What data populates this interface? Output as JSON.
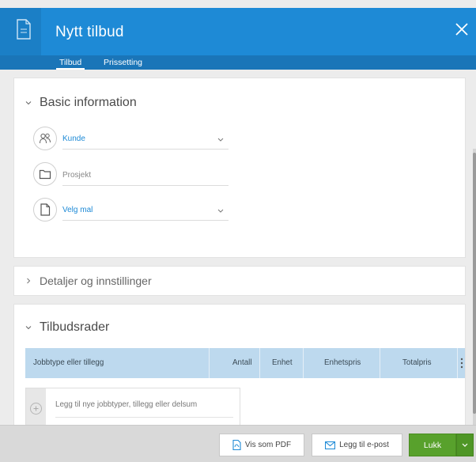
{
  "header": {
    "title": "Nytt tilbud",
    "close_icon": "close-icon",
    "doc_icon": "document-icon"
  },
  "tabs": [
    {
      "label": "Tilbud",
      "active": true
    },
    {
      "label": "Prissetting",
      "active": false
    }
  ],
  "basic": {
    "title": "Basic information",
    "fields": [
      {
        "label": "Kunde",
        "icon": "customer-icon",
        "has_dropdown": true
      },
      {
        "label": "Prosjekt",
        "icon": "folder-icon",
        "has_dropdown": false
      },
      {
        "label": "Velg mal",
        "icon": "template-icon",
        "has_dropdown": true
      }
    ]
  },
  "details": {
    "title": "Detaljer og innstillinger"
  },
  "lines": {
    "title": "Tilbudsrader",
    "columns": [
      "Jobbtype eller tillegg",
      "Antall",
      "Enhet",
      "Enhetspris",
      "Totalpris"
    ],
    "add_placeholder": "Legg til nye jobbtyper, tillegg eller delsum"
  },
  "footer": {
    "pdf_label": "Vis som PDF",
    "email_label": "Legg til e-post",
    "close_label": "Lukk"
  },
  "colors": {
    "primary": "#1e8ad6",
    "tab_bar": "#1a75b8",
    "success": "#58a12c",
    "table_head": "#bdd9ee"
  }
}
